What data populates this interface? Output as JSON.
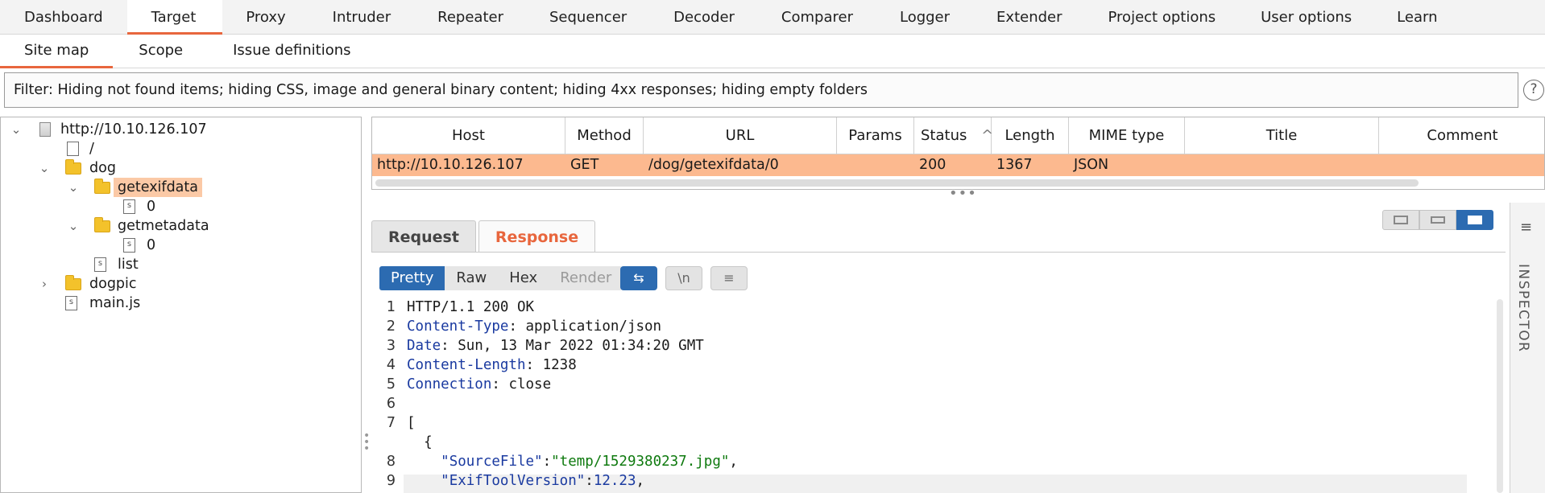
{
  "top_tabs": [
    "Dashboard",
    "Target",
    "Proxy",
    "Intruder",
    "Repeater",
    "Sequencer",
    "Decoder",
    "Comparer",
    "Logger",
    "Extender",
    "Project options",
    "User options",
    "Learn"
  ],
  "sub_tabs": [
    "Site map",
    "Scope",
    "Issue definitions"
  ],
  "filter_text": "Filter: Hiding not found items;  hiding CSS, image and general binary content;  hiding 4xx responses;  hiding empty folders",
  "help_glyph": "?",
  "tree": {
    "host": "http://10.10.126.107",
    "root": "/",
    "dog": "dog",
    "getexifdata": "getexifdata",
    "getexifdata_child": "0",
    "getmetadata": "getmetadata",
    "getmetadata_child": "0",
    "list": "list",
    "dogpic": "dogpic",
    "mainjs": "main.js"
  },
  "table": {
    "headers": [
      "Host",
      "Method",
      "URL",
      "Params",
      "Status",
      "Length",
      "MIME type",
      "Title",
      "Comment"
    ],
    "sort_glyph": "^",
    "row": {
      "host": "http://10.10.126.107",
      "method": "GET",
      "url": "/dog/getexifdata/0",
      "params": "",
      "status": "200",
      "length": "1367",
      "mime": "JSON",
      "title": "",
      "comment": ""
    }
  },
  "rr_tabs": [
    "Request",
    "Response"
  ],
  "format_tabs": [
    "Pretty",
    "Raw",
    "Hex",
    "Render"
  ],
  "tool_glyphs": {
    "wrap": "⇆",
    "newline": "\\n",
    "menu": "≡"
  },
  "response_lines": [
    {
      "n": "1",
      "text": "HTTP/1.1 200 OK"
    },
    {
      "n": "2",
      "key": "Content-Type",
      "val": "application/json"
    },
    {
      "n": "3",
      "key": "Date",
      "val": "Sun, 13 Mar 2022 01:34:20 GMT"
    },
    {
      "n": "4",
      "key": "Content-Length",
      "val": "1238"
    },
    {
      "n": "5",
      "key": "Connection",
      "val": "close"
    },
    {
      "n": "6",
      "text": ""
    },
    {
      "n": "7",
      "text": "["
    },
    {
      "n": "",
      "text": "  {"
    },
    {
      "n": "8",
      "jkey": "\"SourceFile\"",
      "jval": "\"temp/1529380237.jpg\"",
      "sep": ","
    },
    {
      "n": "9",
      "jkey": "\"ExifToolVersion\"",
      "jval": "12.23",
      "sep": ","
    }
  ],
  "inspector": {
    "label": "INSPECTOR",
    "icon": "inspector-list-icon"
  },
  "colors": {
    "accent": "#e8663d",
    "selection": "#fcb98f",
    "primary": "#2c6bb1"
  }
}
